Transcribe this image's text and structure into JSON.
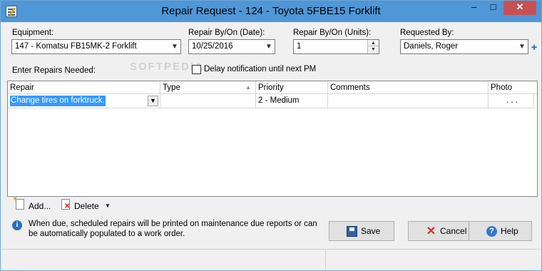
{
  "window": {
    "title": "Repair Request - 124 - Toyota 5FBE15 Forklift",
    "controls": {
      "minimize": "–",
      "maximize": "□",
      "close": "✕"
    }
  },
  "form": {
    "equipment": {
      "label": "Equipment:",
      "value": "147 - Komatsu FB15MK-2 Forklift"
    },
    "repair_by_date": {
      "label": "Repair By/On (Date):",
      "value": "10/25/2016"
    },
    "repair_by_units": {
      "label": "Repair By/On (Units):",
      "value": "1"
    },
    "requested_by": {
      "label": "Requested By:",
      "value": "Daniels, Roger"
    },
    "enter_repairs_label": "Enter Repairs Needed:",
    "delay_notification": {
      "label": "Delay notification until next PM",
      "checked": false
    }
  },
  "grid": {
    "columns": [
      "Repair",
      "Type",
      "Priority",
      "Comments",
      "Photo"
    ],
    "rows": [
      {
        "repair": "Change tires on forktruck.",
        "type": "",
        "priority": "2 - Medium",
        "comments": "",
        "photo": ". . ."
      }
    ]
  },
  "toolbar": {
    "add_label": "Add...",
    "delete_label": "Delete"
  },
  "info": {
    "text": "When due, scheduled repairs will be printed on maintenance due reports or can be automatically populated to a work order."
  },
  "buttons": {
    "save": "Save",
    "cancel": "Cancel",
    "help": "Help"
  },
  "watermark": "SOFTPEDIA",
  "icons": [
    "app-icon",
    "dropdown-arrow-icon",
    "spin-up-icon",
    "spin-down-icon",
    "add-user-icon",
    "sort-icon",
    "add-icon",
    "delete-icon",
    "info-icon",
    "save-icon",
    "cancel-icon",
    "help-icon"
  ],
  "colors": {
    "titlebar": "#4f97d6",
    "close_button": "#c75050",
    "selection": "#3399ff"
  }
}
